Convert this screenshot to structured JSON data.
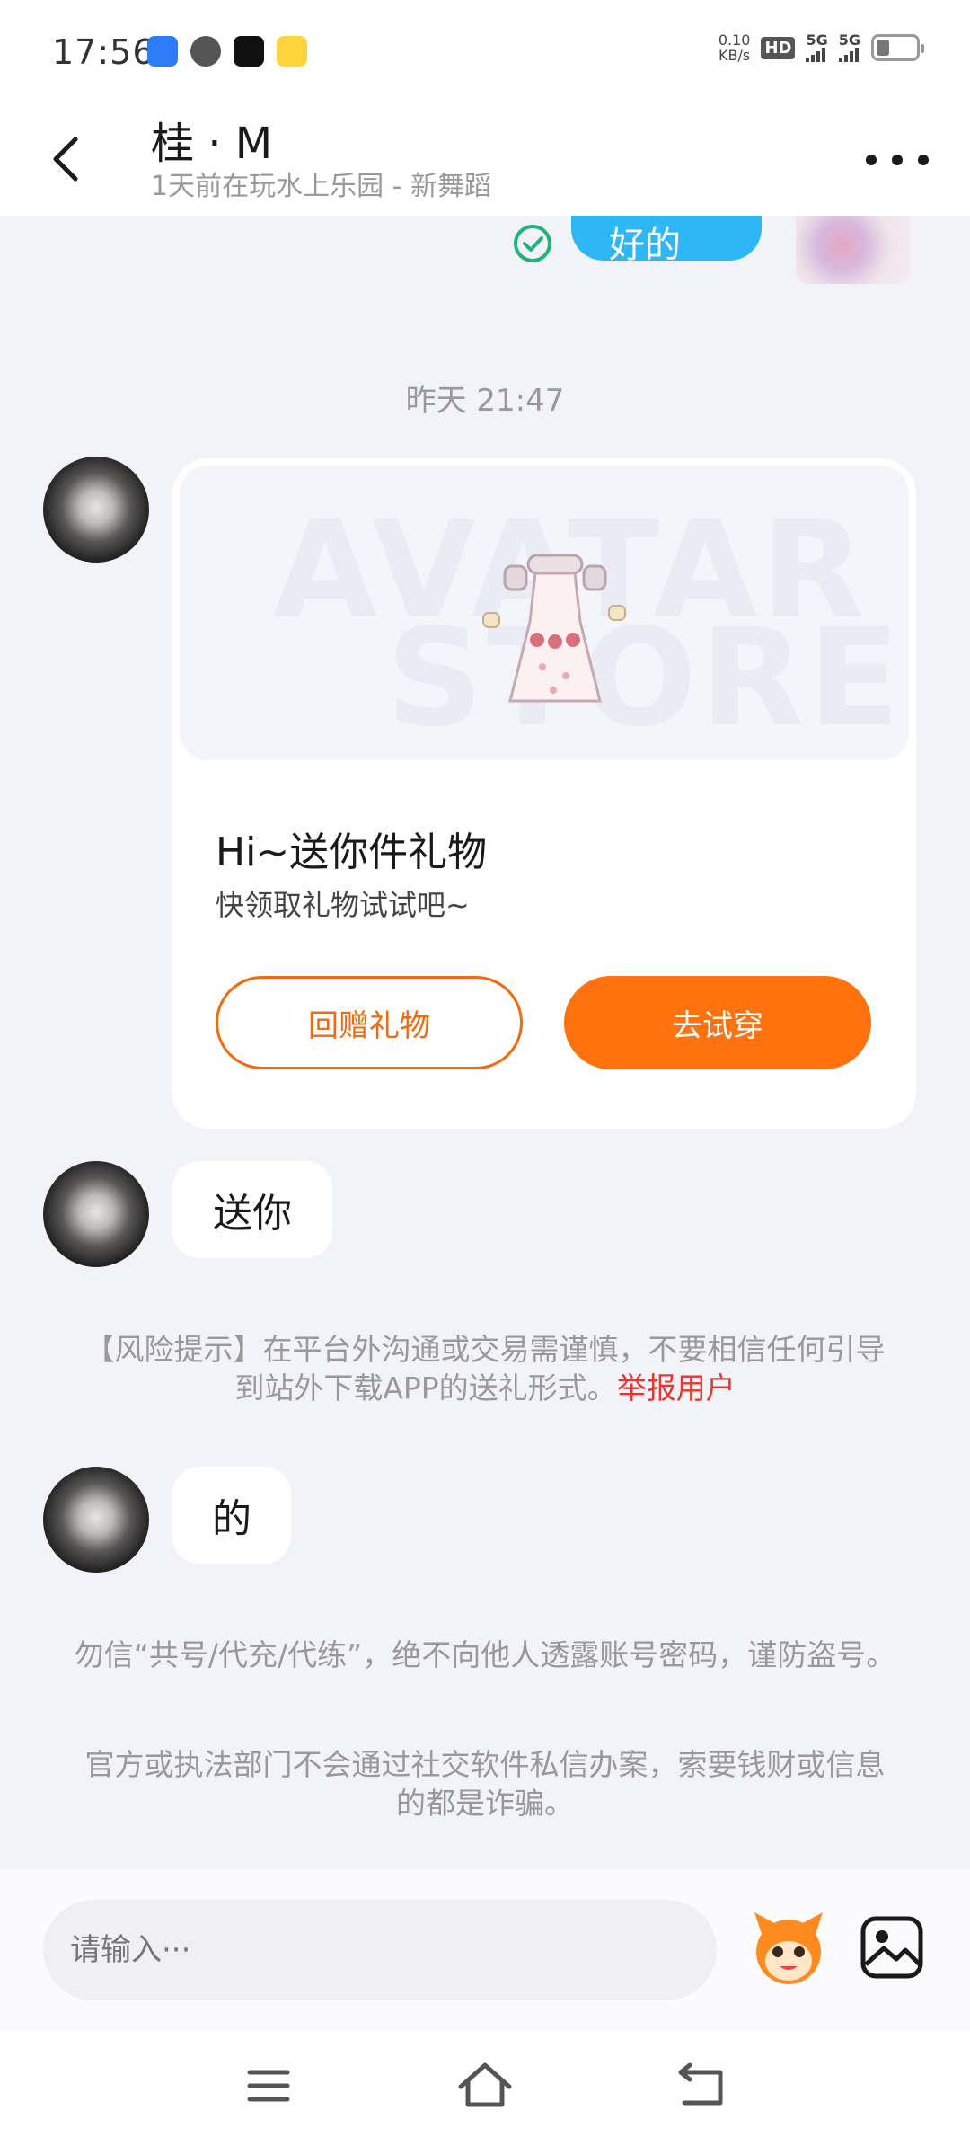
{
  "status_bar": {
    "time": "17:56",
    "net_speed_value": "0.10",
    "net_speed_unit": "KB/s",
    "hd_badge": "HD",
    "sim1_label": "5G",
    "sim2_label": "5G",
    "app_icons": [
      "cloud-app-icon",
      "message-app-icon",
      "tiktok-app-icon",
      "yellow-app-icon"
    ]
  },
  "header": {
    "title": "桂 · M",
    "subtitle": "1天前在玩水上乐园 - 新舞蹈"
  },
  "chat": {
    "previous_message_text": "好的",
    "timestamp": "昨天 21:47",
    "gift_card": {
      "watermark_line1": "AVATAR",
      "watermark_line2": "STORE",
      "title": "Hi~送你件礼物",
      "description": "快领取礼物试试吧~",
      "return_gift_label": "回赠礼物",
      "try_on_label": "去试穿"
    },
    "message_1": "送你",
    "risk_notice_text": "【风险提示】在平台外沟通或交易需谨慎，不要相信任何引导到站外下载APP的送礼形式。",
    "report_link": "举报用户",
    "message_2": "的",
    "notice_2": "勿信“共号/代充/代练”，绝不向他人透露账号密码，谨防盗号。",
    "notice_3": "官方或执法部门不会通过社交软件私信办案，索要钱财或信息的都是诈骗。"
  },
  "input_bar": {
    "placeholder": "请输入···"
  },
  "colors": {
    "accent_orange": "#ff720d",
    "sent_bubble_blue": "#2eb6f5",
    "report_red": "#e8352f",
    "check_green": "#21b37a",
    "page_background": "#f2f3f8"
  },
  "icons": {
    "back": "back-arrow-icon",
    "more": "more-dots-icon",
    "sent_check": "check-circle-icon",
    "emoji": "mascot-emoji-icon",
    "image": "image-picture-icon",
    "nav_menu": "menu-lines-icon",
    "nav_home": "home-icon",
    "nav_back": "return-icon"
  }
}
